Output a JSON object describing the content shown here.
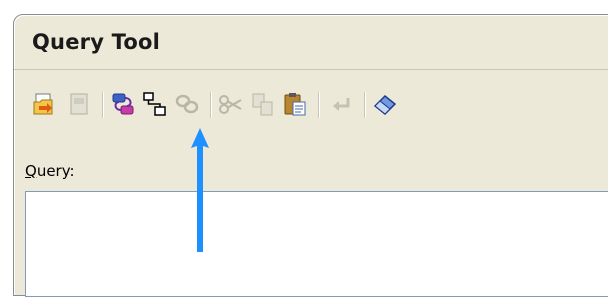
{
  "window": {
    "title": "Query Tool"
  },
  "toolbar": {
    "buttons": [
      {
        "name": "open-file",
        "enabled": true
      },
      {
        "name": "save-file",
        "enabled": false
      },
      {
        "name": "link-tables",
        "enabled": true
      },
      {
        "name": "new-query-window",
        "enabled": true,
        "highlighted": true
      },
      {
        "name": "clear-links",
        "enabled": false
      },
      {
        "name": "cut",
        "enabled": false
      },
      {
        "name": "copy",
        "enabled": false
      },
      {
        "name": "paste",
        "enabled": true
      },
      {
        "name": "undo",
        "enabled": false
      },
      {
        "name": "execute-eraser",
        "enabled": true
      }
    ]
  },
  "query": {
    "label": "Query:",
    "label_accesskey": "Q",
    "value": ""
  },
  "annotation": {
    "arrow_color": "#1e90ff"
  }
}
